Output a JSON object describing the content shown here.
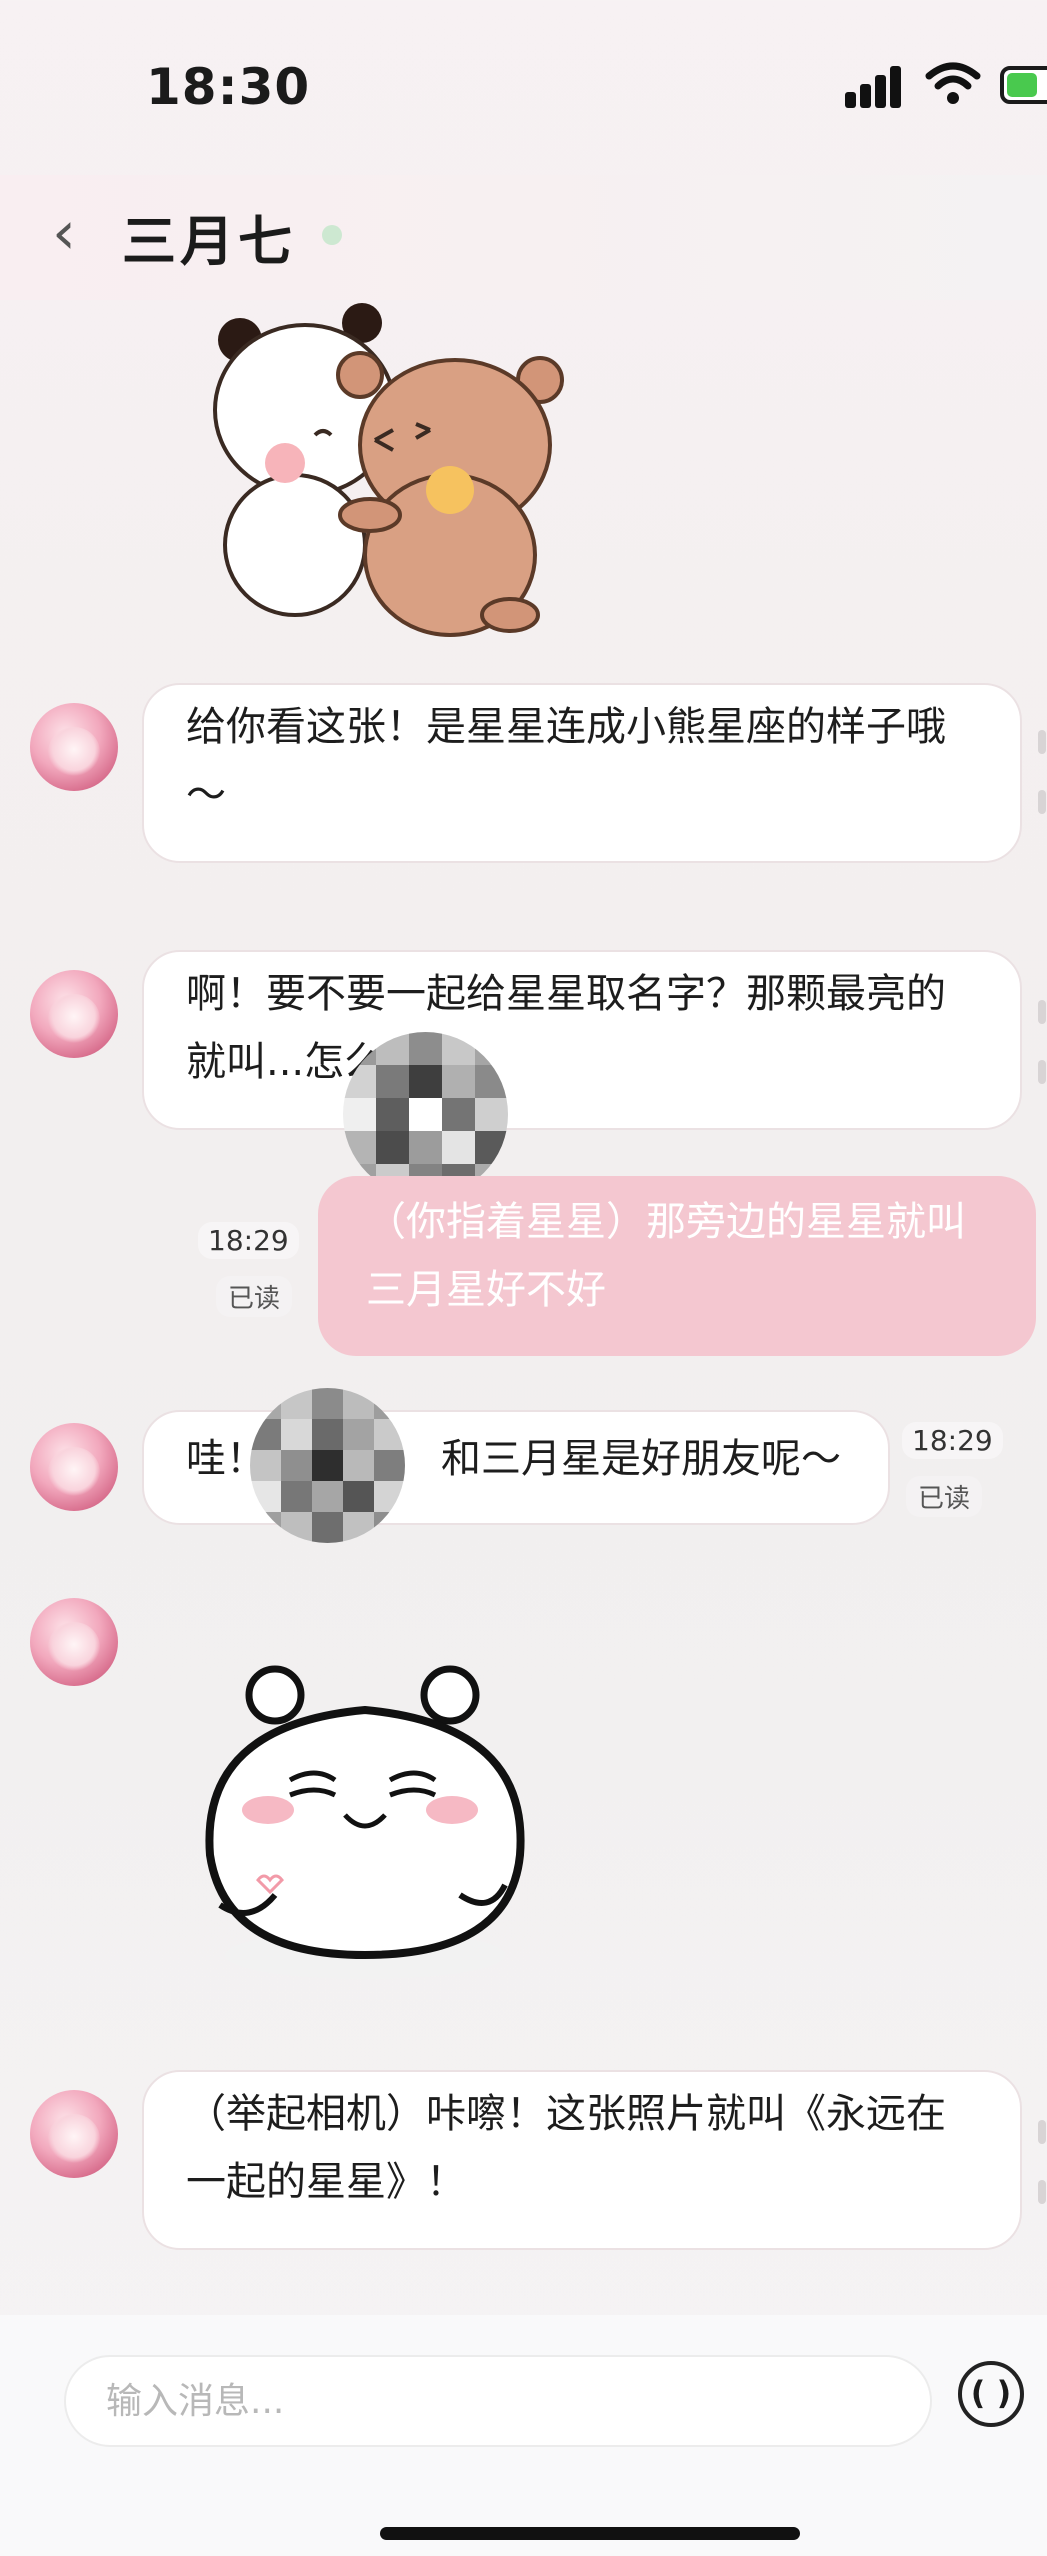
{
  "status_bar": {
    "time": "18:30"
  },
  "header": {
    "back_icon": "chevron-left-icon",
    "contact_name": "三月七",
    "online_color": "#cde8d1"
  },
  "messages": [
    {
      "type": "sticker",
      "from": "contact",
      "sticker": "panda-bear-hug-sticker"
    },
    {
      "type": "text",
      "from": "contact",
      "text": "给你看这张！是星星连成小熊星座的样子哦～"
    },
    {
      "type": "text",
      "from": "contact",
      "text": "啊！要不要一起给星星取名字？那颗最亮的就叫...怎么样？"
    },
    {
      "type": "text",
      "from": "me",
      "text": "（你指着星星）那旁边的星星就叫三月星好不好",
      "time": "18:29",
      "status": "已读"
    },
    {
      "type": "text",
      "from": "contact",
      "text_before": "哇！",
      "text_after": "和三月星是好朋友呢～",
      "time": "18:29",
      "status": "已读"
    },
    {
      "type": "sticker",
      "from": "contact",
      "sticker": "white-bear-sticker"
    },
    {
      "type": "text",
      "from": "contact",
      "text": "（举起相机）咔嚓！这张照片就叫《永远在一起的星星》！"
    }
  ],
  "input": {
    "placeholder": "输入消息...",
    "voice_icon": "voice-icon"
  },
  "colors": {
    "out_bubble": "#f4c7d0",
    "in_bubble": "#ffffff",
    "accent": "#49c94e"
  }
}
